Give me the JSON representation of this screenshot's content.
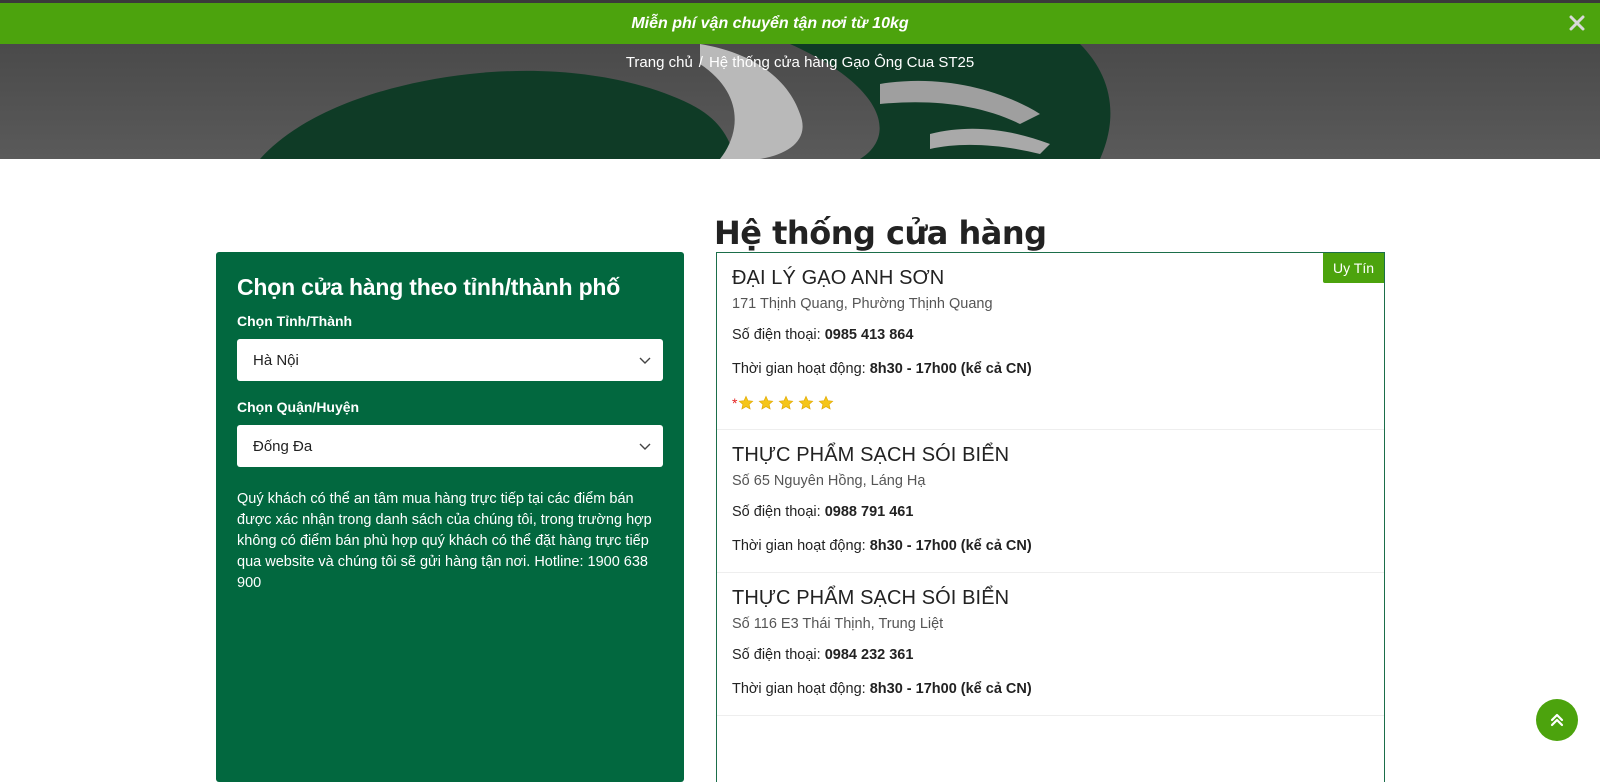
{
  "announcement": {
    "text": "Miễn phí vận chuyển tận nơi từ 10kg",
    "close_icon": "close-icon"
  },
  "breadcrumb": {
    "home": "Trang chủ",
    "separator": "/",
    "current": "Hệ thống cửa hàng Gạo Ông Cua ST25"
  },
  "side_panel": {
    "title": "Chọn cửa hàng theo tỉnh/thành phố",
    "province_label": "Chọn Tỉnh/Thành",
    "province_value": "Hà Nội",
    "district_label": "Chọn Quận/Huyện",
    "district_value": "Đống Đa",
    "description": "Quý khách có thể an tâm mua hàng trực tiếp tại các điểm bán được xác nhận trong danh sách của chúng tôi, trong trường hợp không có điểm bán phù hợp quý khách có thể đặt hàng trực tiếp qua website và chúng tôi sẽ gửi hàng tận nơi. Hotline: 1900 638 900"
  },
  "main": {
    "title": "Hệ thống cửa hàng",
    "badge": "Uy Tín",
    "stores": [
      {
        "name": "ĐẠI LÝ GẠO ANH SƠN",
        "address": "171 Thịnh Quang, Phường Thịnh Quang",
        "phone_label": "Số điện thoại",
        "phone": "0985 413 864",
        "hours_label": "Thời gian hoạt động",
        "hours": "8h30 - 17h00 (kể cả CN)",
        "rating_required_mark": "*",
        "rating": 5
      },
      {
        "name": "THỰC PHẨM SẠCH SÓI BIỂN",
        "address": "Số 65 Nguyên Hồng, Láng Hạ",
        "phone_label": "Số điện thoại",
        "phone": "0988 791 461",
        "hours_label": "Thời gian hoạt động",
        "hours": "8h30 - 17h00 (kể cả CN)"
      },
      {
        "name": "THỰC PHẨM SẠCH SÓI BIỂN",
        "address": "Số 116 E3 Thái Thịnh, Trung Liệt",
        "phone_label": "Số điện thoại",
        "phone": "0984 232 361",
        "hours_label": "Thời gian hoạt động",
        "hours": "8h30 - 17h00 (kể cả CN)"
      }
    ]
  },
  "colors": {
    "accent_green": "#4ca30d",
    "panel_green": "#02683f",
    "star": "#f5c518"
  },
  "scroll_top_icon": "double-chevron-up-icon"
}
